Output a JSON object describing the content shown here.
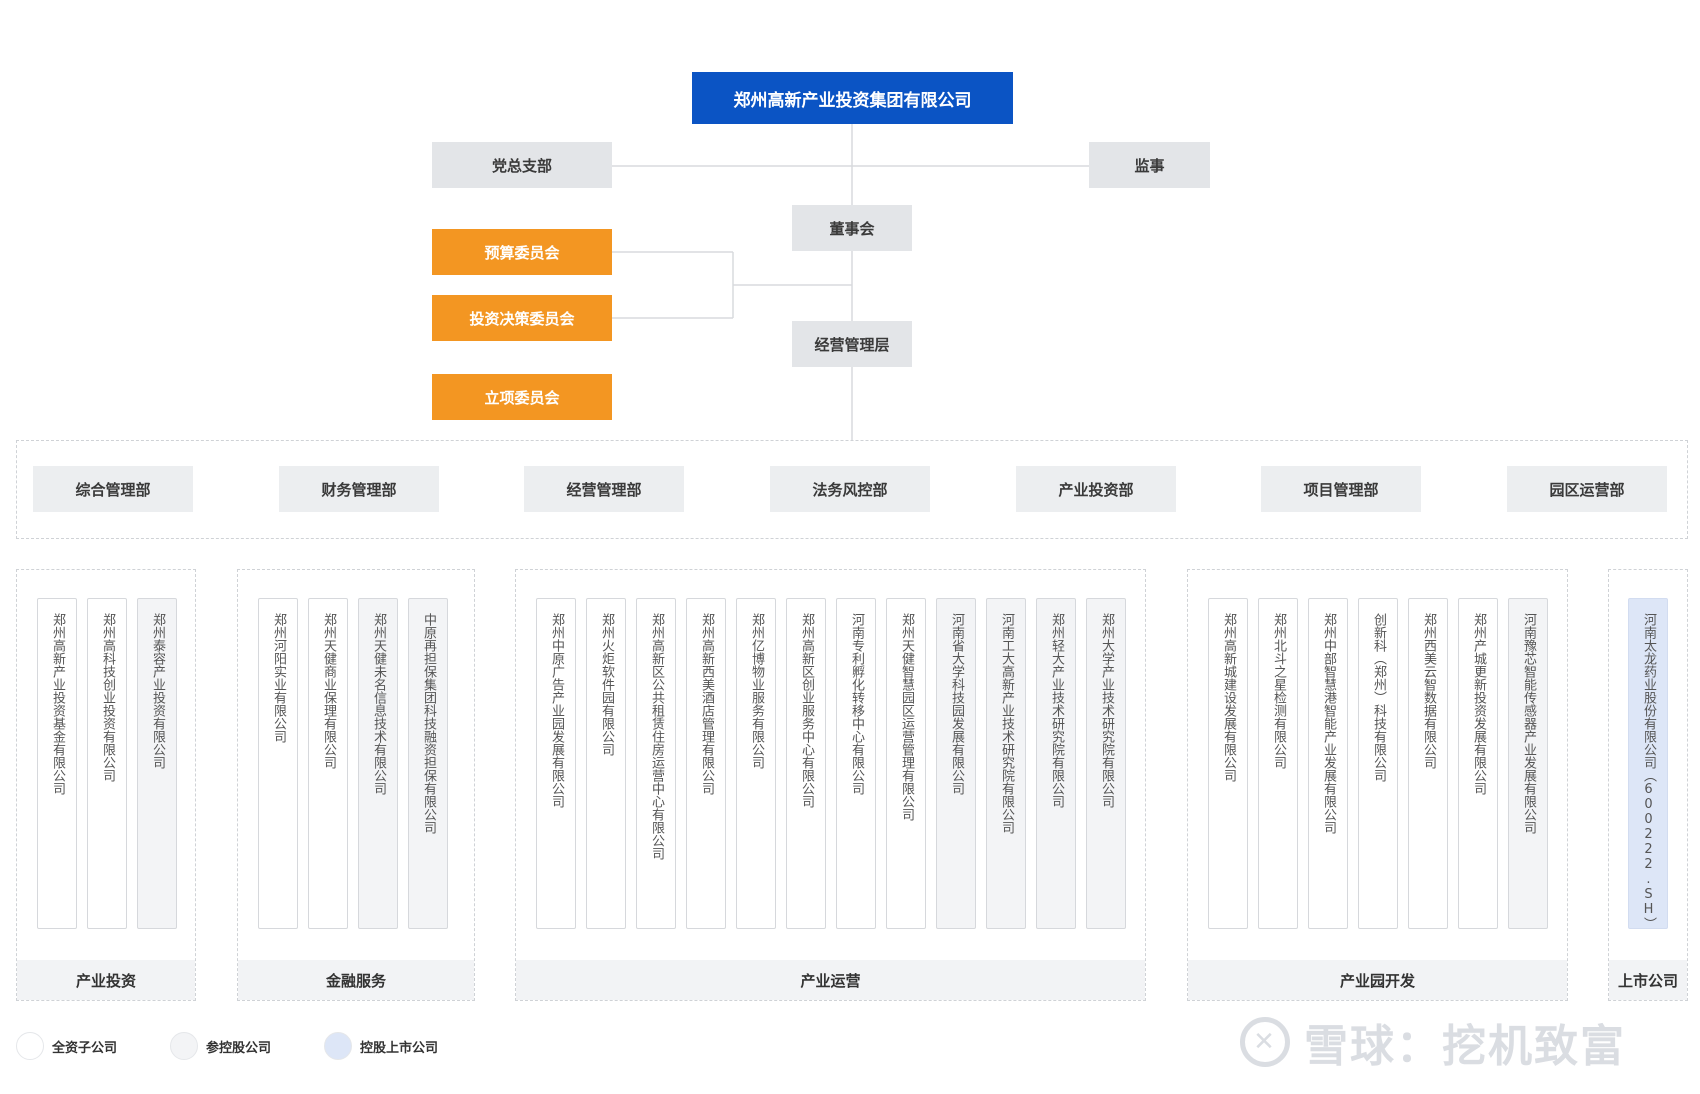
{
  "top": "郑州高新产业投资集团有限公司",
  "party_branch": "党总支部",
  "supervisor": "监事",
  "board": "董事会",
  "management": "经营管理层",
  "committees": [
    "预算委员会",
    "投资决策委员会",
    "立项委员会"
  ],
  "departments": [
    "综合管理部",
    "财务管理部",
    "经营管理部",
    "法务风控部",
    "产业投资部",
    "项目管理部",
    "园区运营部"
  ],
  "groups": [
    {
      "label": "产业投资",
      "companies": [
        {
          "name": "郑州高新产业投资基金有限公司",
          "type": "white"
        },
        {
          "name": "郑州高科技创业投资有限公司",
          "type": "white"
        },
        {
          "name": "郑州泰容产业投资有限公司",
          "type": "gray"
        }
      ]
    },
    {
      "label": "金融服务",
      "companies": [
        {
          "name": "郑州河阳实业有限公司",
          "type": "white"
        },
        {
          "name": "郑州天健商业保理有限公司",
          "type": "white"
        },
        {
          "name": "郑州天健未名信息技术有限公司",
          "type": "gray"
        },
        {
          "name": "中原再担保集团科技融资担保有限公司",
          "type": "gray"
        }
      ]
    },
    {
      "label": "产业运营",
      "companies": [
        {
          "name": "郑州中原广告产业园发展有限公司",
          "type": "white"
        },
        {
          "name": "郑州火炬软件园有限公司",
          "type": "white"
        },
        {
          "name": "郑州高新区公共租赁住房运营中心有限公司",
          "type": "white"
        },
        {
          "name": "郑州高新西美酒店管理有限公司",
          "type": "white"
        },
        {
          "name": "郑州亿博物业服务有限公司",
          "type": "white"
        },
        {
          "name": "郑州高新区创业服务中心有限公司",
          "type": "white"
        },
        {
          "name": "河南专利孵化转移中心有限公司",
          "type": "white"
        },
        {
          "name": "郑州天健智慧园区运营管理有限公司",
          "type": "white"
        },
        {
          "name": "河南省大学科技园发展有限公司",
          "type": "gray"
        },
        {
          "name": "河南工大高新产业技术研究院有限公司",
          "type": "gray"
        },
        {
          "name": "郑州轻大产业技术研究院有限公司",
          "type": "gray"
        },
        {
          "name": "郑州大学产业技术研究院有限公司",
          "type": "gray"
        }
      ]
    },
    {
      "label": "产业园开发",
      "companies": [
        {
          "name": "郑州高新城建设发展有限公司",
          "type": "white"
        },
        {
          "name": "郑州北斗之星检测有限公司",
          "type": "white"
        },
        {
          "name": "郑州中部智慧港智能产业发展有限公司",
          "type": "white"
        },
        {
          "name": "创新科（郑州）科技有限公司",
          "type": "white"
        },
        {
          "name": "郑州西美云智数据有限公司",
          "type": "white"
        },
        {
          "name": "郑州产城更新投资发展有限公司",
          "type": "white"
        },
        {
          "name": "河南豫芯智能传感器产业发展有限公司",
          "type": "gray"
        }
      ]
    },
    {
      "label": "上市公司",
      "companies": [
        {
          "name": "河南太龙药业股份有限公司（600222.SH）",
          "type": "blue"
        }
      ]
    }
  ],
  "legend": [
    {
      "label": "全资子公司",
      "color": "#ffffff"
    },
    {
      "label": "参控股公司",
      "color": "#f3f4f6"
    },
    {
      "label": "控股上市公司",
      "color": "#dde6f7"
    }
  ],
  "watermark": "雪球：挖机致富"
}
